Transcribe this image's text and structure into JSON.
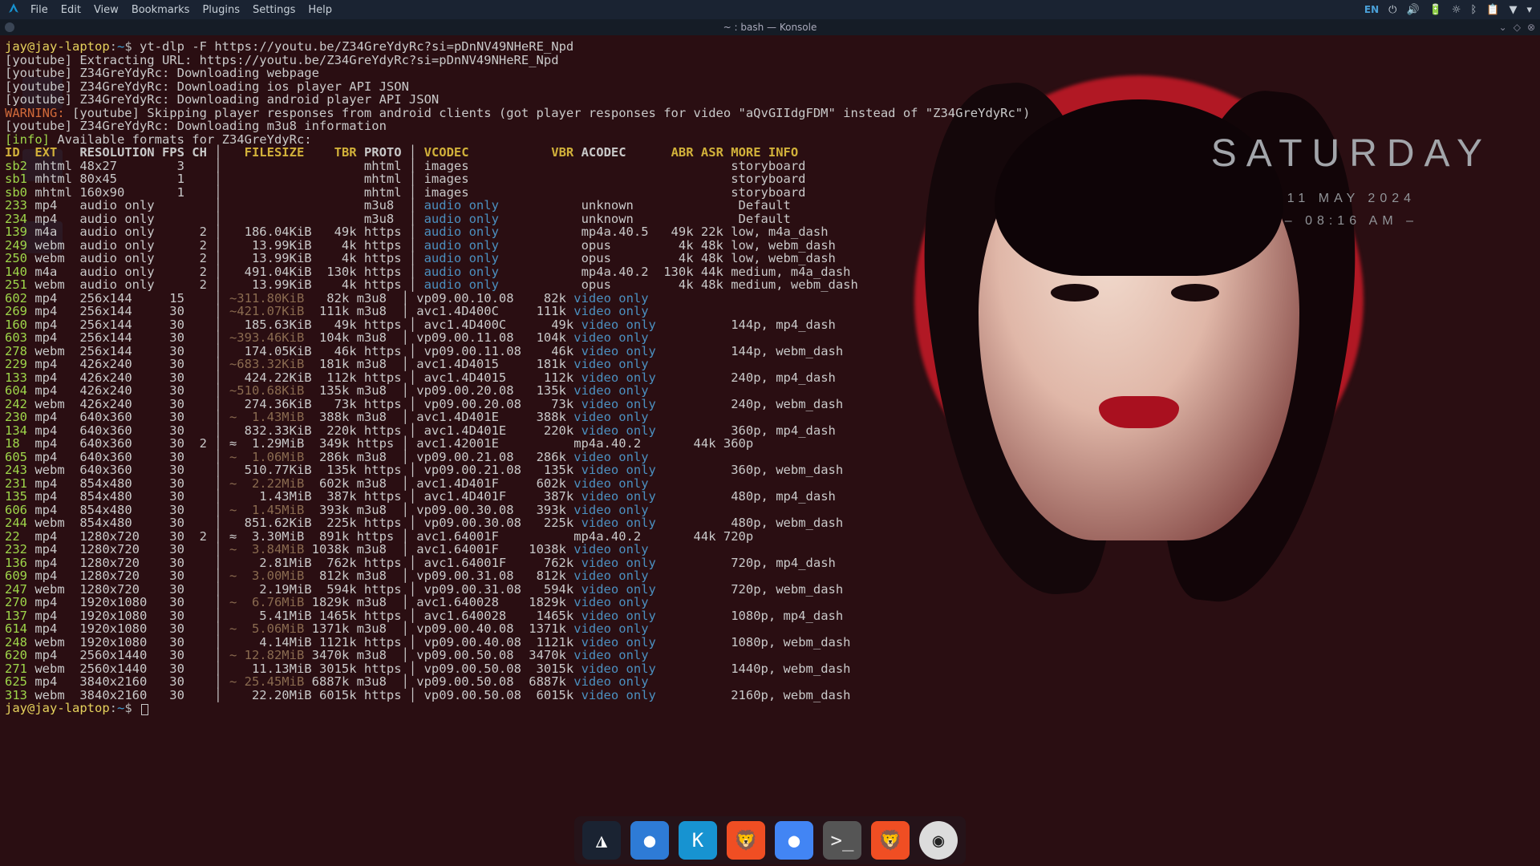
{
  "panel": {
    "menu": [
      "File",
      "Edit",
      "View",
      "Bookmarks",
      "Plugins",
      "Settings",
      "Help"
    ],
    "lang": "EN"
  },
  "window": {
    "title": "~ : bash — Konsole"
  },
  "clock": {
    "day": "SATURDAY",
    "date": "11 MAY 2024",
    "time": "– 08:16 AM –"
  },
  "ps1": {
    "user_host": "jay@jay-laptop",
    "path": "~",
    "cmd": "yt-dlp -F https://youtu.be/Z34GreYdyRc?si=pDnNV49NHeRE_Npd"
  },
  "log": [
    "[youtube] Extracting URL: https://youtu.be/Z34GreYdyRc?si=pDnNV49NHeRE_Npd",
    "[youtube] Z34GreYdyRc: Downloading webpage",
    "[youtube] Z34GreYdyRc: Downloading ios player API JSON",
    "[youtube] Z34GreYdyRc: Downloading android player API JSON"
  ],
  "warning": "WARNING: [youtube] Skipping player responses from android clients (got player responses for video \"aQvGIIdgFDM\" instead of \"Z34GreYdyRc\")",
  "log2": "[youtube] Z34GreYdyRc: Downloading m3u8 information",
  "info": "[info] Available formats for Z34GreYdyRc:",
  "header": "ID  EXT   RESOLUTION FPS CH │   FILESIZE    TBR PROTO │ VCODEC           VBR ACODEC      ABR ASR MORE INFO",
  "rows": [
    [
      "sb2",
      " mhtml 48x27        3    │                   mhtml │ images                                   storyboard"
    ],
    [
      "sb1",
      " mhtml 80x45        1    │                   mhtml │ images                                   storyboard"
    ],
    [
      "sb0",
      " mhtml 160x90       1    │                   mhtml │ images                                   storyboard"
    ],
    [
      "233",
      " mp4   audio only        │                   m3u8  │ ",
      "audio only",
      "           unknown              Default"
    ],
    [
      "234",
      " mp4   audio only        │                   m3u8  │ ",
      "audio only",
      "           unknown              Default"
    ],
    [
      "139",
      " m4a   audio only      2 │   186.04KiB   49k https │ ",
      "audio only",
      "           mp4a.40.5   49k 22k low, m4a_dash"
    ],
    [
      "249",
      " webm  audio only      2 │    13.99KiB    4k https │ ",
      "audio only",
      "           opus         4k 48k low, webm_dash"
    ],
    [
      "250",
      " webm  audio only      2 │    13.99KiB    4k https │ ",
      "audio only",
      "           opus         4k 48k low, webm_dash"
    ],
    [
      "140",
      " m4a   audio only      2 │   491.04KiB  130k https │ ",
      "audio only",
      "           mp4a.40.2  130k 44k medium, m4a_dash"
    ],
    [
      "251",
      " webm  audio only      2 │    13.99KiB    4k https │ ",
      "audio only",
      "           opus         4k 48k medium, webm_dash"
    ],
    [
      "602",
      " mp4   256x144     15    │ ",
      "~311.80KiB",
      "   82k m3u8  │ vp09.00.10.08    82k ",
      "video only"
    ],
    [
      "269",
      " mp4   256x144     30    │ ",
      "~421.07KiB",
      "  111k m3u8  │ avc1.4D400C     111k ",
      "video only"
    ],
    [
      "160",
      " mp4   256x144     30    │   185.63KiB   49k https │ avc1.4D400C      49k ",
      "video only",
      "          144p, mp4_dash"
    ],
    [
      "603",
      " mp4   256x144     30    │ ",
      "~393.46KiB",
      "  104k m3u8  │ vp09.00.11.08   104k ",
      "video only"
    ],
    [
      "278",
      " webm  256x144     30    │   174.05KiB   46k https │ vp09.00.11.08    46k ",
      "video only",
      "          144p, webm_dash"
    ],
    [
      "229",
      " mp4   426x240     30    │ ",
      "~683.32KiB",
      "  181k m3u8  │ avc1.4D4015     181k ",
      "video only"
    ],
    [
      "133",
      " mp4   426x240     30    │   424.22KiB  112k https │ avc1.4D4015     112k ",
      "video only",
      "          240p, mp4_dash"
    ],
    [
      "604",
      " mp4   426x240     30    │ ",
      "~510.68KiB",
      "  135k m3u8  │ vp09.00.20.08   135k ",
      "video only"
    ],
    [
      "242",
      " webm  426x240     30    │   274.36KiB   73k https │ vp09.00.20.08    73k ",
      "video only",
      "          240p, webm_dash"
    ],
    [
      "230",
      " mp4   640x360     30    │ ",
      "~  1.43MiB",
      "  388k m3u8  │ avc1.4D401E     388k ",
      "video only"
    ],
    [
      "134",
      " mp4   640x360     30    │   832.33KiB  220k https │ avc1.4D401E     220k ",
      "video only",
      "          360p, mp4_dash"
    ],
    [
      "18",
      "  mp4   640x360     30  2 │ ≈  1.29MiB  349k https │ avc1.42001E          mp4a.40.2       44k 360p"
    ],
    [
      "605",
      " mp4   640x360     30    │ ",
      "~  1.06MiB",
      "  286k m3u8  │ vp09.00.21.08   286k ",
      "video only"
    ],
    [
      "243",
      " webm  640x360     30    │   510.77KiB  135k https │ vp09.00.21.08   135k ",
      "video only",
      "          360p, webm_dash"
    ],
    [
      "231",
      " mp4   854x480     30    │ ",
      "~  2.22MiB",
      "  602k m3u8  │ avc1.4D401F     602k ",
      "video only"
    ],
    [
      "135",
      " mp4   854x480     30    │     1.43MiB  387k https │ avc1.4D401F     387k ",
      "video only",
      "          480p, mp4_dash"
    ],
    [
      "606",
      " mp4   854x480     30    │ ",
      "~  1.45MiB",
      "  393k m3u8  │ vp09.00.30.08   393k ",
      "video only"
    ],
    [
      "244",
      " webm  854x480     30    │   851.62KiB  225k https │ vp09.00.30.08   225k ",
      "video only",
      "          480p, webm_dash"
    ],
    [
      "22",
      "  mp4   1280x720    30  2 │ ≈  3.30MiB  891k https │ avc1.64001F          mp4a.40.2       44k 720p"
    ],
    [
      "232",
      " mp4   1280x720    30    │ ",
      "~  3.84MiB",
      " 1038k m3u8  │ avc1.64001F    1038k ",
      "video only"
    ],
    [
      "136",
      " mp4   1280x720    30    │     2.81MiB  762k https │ avc1.64001F     762k ",
      "video only",
      "          720p, mp4_dash"
    ],
    [
      "609",
      " mp4   1280x720    30    │ ",
      "~  3.00MiB",
      "  812k m3u8  │ vp09.00.31.08   812k ",
      "video only"
    ],
    [
      "247",
      " webm  1280x720    30    │     2.19MiB  594k https │ vp09.00.31.08   594k ",
      "video only",
      "          720p, webm_dash"
    ],
    [
      "270",
      " mp4   1920x1080   30    │ ",
      "~  6.76MiB",
      " 1829k m3u8  │ avc1.640028    1829k ",
      "video only"
    ],
    [
      "137",
      " mp4   1920x1080   30    │     5.41MiB 1465k https │ avc1.640028    1465k ",
      "video only",
      "          1080p, mp4_dash"
    ],
    [
      "614",
      " mp4   1920x1080   30    │ ",
      "~  5.06MiB",
      " 1371k m3u8  │ vp09.00.40.08  1371k ",
      "video only"
    ],
    [
      "248",
      " webm  1920x1080   30    │     4.14MiB 1121k https │ vp09.00.40.08  1121k ",
      "video only",
      "          1080p, webm_dash"
    ],
    [
      "620",
      " mp4   2560x1440   30    │ ",
      "~ 12.82MiB",
      " 3470k m3u8  │ vp09.00.50.08  3470k ",
      "video only"
    ],
    [
      "271",
      " webm  2560x1440   30    │    11.13MiB 3015k https │ vp09.00.50.08  3015k ",
      "video only",
      "          1440p, webm_dash"
    ],
    [
      "625",
      " mp4   3840x2160   30    │ ",
      "~ 25.45MiB",
      " 6887k m3u8  │ vp09.00.50.08  6887k ",
      "video only"
    ],
    [
      "313",
      " webm  3840x2160   30    │    22.20MiB 6015k https │ vp09.00.50.08  6015k ",
      "video only",
      "          2160p, webm_dash"
    ]
  ],
  "dock": [
    {
      "name": "arch-menu",
      "color": "#1a2332",
      "glyph": "◮",
      "fg": "#fff"
    },
    {
      "name": "gnome-weather",
      "color": "#2e7bd6",
      "glyph": "●",
      "fg": "#fff"
    },
    {
      "name": "kate",
      "color": "#1793d1",
      "glyph": "K",
      "fg": "#fff"
    },
    {
      "name": "brave",
      "color": "#f04e23",
      "glyph": "🦁",
      "fg": "#fff"
    },
    {
      "name": "chromium",
      "color": "#4285f4",
      "glyph": "●",
      "fg": "#fff"
    },
    {
      "name": "terminal",
      "color": "#555",
      "glyph": ">_",
      "fg": "#eee"
    },
    {
      "name": "brave-beta",
      "color": "#f04e23",
      "glyph": "🦁",
      "fg": "#fff"
    },
    {
      "name": "obs",
      "color": "#222",
      "glyph": "◉",
      "fg": "#fff",
      "active": true
    }
  ]
}
